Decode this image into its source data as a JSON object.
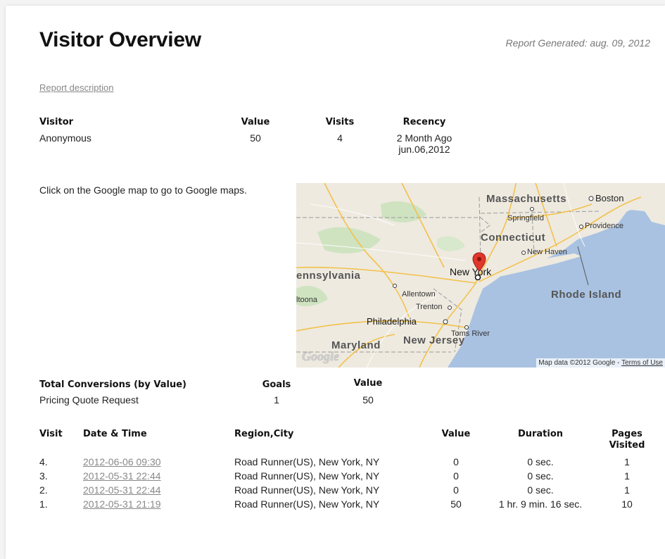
{
  "header": {
    "title": "Visitor Overview",
    "report_generated": "Report Generated: aug. 09, 2012"
  },
  "report_description_link": "Report description",
  "visitor_table": {
    "headers": [
      "Visitor",
      "Value",
      "Visits",
      "Recency"
    ],
    "row": {
      "visitor": "Anonymous",
      "value": "50",
      "visits": "4",
      "recency_line1": "2 Month Ago",
      "recency_line2": "jun.06,2012"
    }
  },
  "map_section": {
    "instruction": "Click on the Google map to go to Google maps.",
    "labels": {
      "massachusetts": "Massachusetts",
      "boston": "Boston",
      "springfield": "Springfield",
      "providence": "Providence",
      "connecticut": "Connecticut",
      "new_haven": "New Haven",
      "pennsylvania": "ennsylvania",
      "new_york": "New York",
      "rhode_island": "Rhode Island",
      "allentown": "Allentown",
      "altoona": "ltoona",
      "trenton": "Trenton",
      "philadelphia": "Philadelphia",
      "toms_river": "Toms River",
      "maryland": "Maryland",
      "new_jersey": "New Jersey",
      "google_logo": "Google",
      "attribution": "Map data ©2012 Google - ",
      "terms": "Terms of Use"
    },
    "colors": {
      "water": "#a9c2e2",
      "land": "#eeeae0",
      "marker": "#e0372c"
    }
  },
  "conversions_table": {
    "headers": [
      "Total Conversions (by Value)",
      "Goals",
      "Value"
    ],
    "row": {
      "name": "Pricing Quote Request",
      "goals": "1",
      "value": "50"
    }
  },
  "visits_table": {
    "headers": {
      "visit": "Visit",
      "datetime": "Date & Time",
      "region": "Region,City",
      "value": "Value",
      "duration": "Duration",
      "pages_line1": "Pages",
      "pages_line2": "Visited"
    },
    "rows": [
      {
        "visit": "4.",
        "datetime": "2012-06-06 09:30",
        "region": "Road Runner(US), New York, NY",
        "value": "0",
        "duration": "0 sec.",
        "pages": "1"
      },
      {
        "visit": "3.",
        "datetime": "2012-05-31 22:44",
        "region": "Road Runner(US), New York, NY",
        "value": "0",
        "duration": "0 sec.",
        "pages": "1"
      },
      {
        "visit": "2.",
        "datetime": "2012-05-31 22:44",
        "region": "Road Runner(US), New York, NY",
        "value": "0",
        "duration": "0 sec.",
        "pages": "1"
      },
      {
        "visit": "1.",
        "datetime": "2012-05-31 21:19",
        "region": "Road Runner(US), New York, NY",
        "value": "50",
        "duration": "1 hr. 9 min. 16 sec.",
        "pages": "10"
      }
    ]
  }
}
